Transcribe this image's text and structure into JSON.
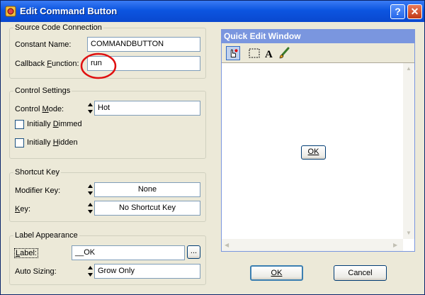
{
  "window": {
    "title": "Edit Command Button"
  },
  "source_code": {
    "group_title": "Source Code Connection",
    "constant_label_pre": "Constant Name:",
    "constant_value": "COMMANDBUTTON",
    "callback_label_a": "Callback ",
    "callback_label_u": "F",
    "callback_label_b": "unction:",
    "callback_value": "run"
  },
  "control_settings": {
    "group_title": "Control Settings",
    "mode_label_a": "Control ",
    "mode_label_u": "M",
    "mode_label_b": "ode:",
    "mode_value": "Hot",
    "dimmed_a": "Initially ",
    "dimmed_u": "D",
    "dimmed_b": "immed",
    "dimmed_checked": false,
    "hidden_a": "Initially ",
    "hidden_u": "H",
    "hidden_b": "idden",
    "hidden_checked": false
  },
  "shortcut": {
    "group_title": "Shortcut Key",
    "modifier_label": "Modifier Key:",
    "modifier_value": "None",
    "key_label_u": "K",
    "key_label_b": "ey:",
    "key_value": "No Shortcut Key"
  },
  "label_appearance": {
    "group_title": "Label Appearance",
    "label_u": "L",
    "label_b": "abel:",
    "label_value": "__OK",
    "browse_label": "...",
    "autosize_label": "Auto Sizing:",
    "autosize_value": "Grow Only"
  },
  "quick_edit": {
    "title": "Quick Edit Window",
    "preview_button": "OK",
    "tools": [
      "hand-pointer-icon",
      "selection-rect-icon",
      "text-A-icon",
      "brush-icon"
    ]
  },
  "footer": {
    "ok_label": "OK",
    "cancel_label": "Cancel"
  },
  "colors": {
    "title_bar": "#0a48cf",
    "dialog_bg": "#ece9d8",
    "highlight_circle": "#e01010",
    "quick_edit_title": "#7a96df"
  }
}
